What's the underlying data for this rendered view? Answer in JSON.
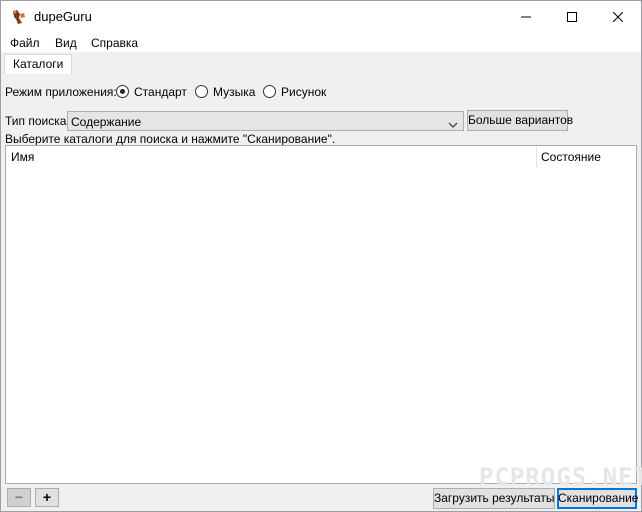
{
  "window": {
    "title": "dupeGuru",
    "controls": [
      "minimize-icon",
      "maximize-icon",
      "close-icon"
    ]
  },
  "menu": {
    "items": [
      {
        "label": "Файл"
      },
      {
        "label": "Вид"
      },
      {
        "label": "Справка"
      }
    ]
  },
  "tabs": [
    {
      "label": "Каталоги",
      "active": true
    }
  ],
  "mode": {
    "label": "Режим приложения:",
    "options": [
      {
        "label": "Стандарт",
        "checked": true
      },
      {
        "label": "Музыка",
        "checked": false
      },
      {
        "label": "Рисунок",
        "checked": false
      }
    ]
  },
  "search": {
    "label": "Тип поиска:",
    "selected": "Содержание",
    "more_button": "Больше вариантов"
  },
  "hint": "Выберите каталоги для поиска и нажмите \"Сканирование\".",
  "table": {
    "columns": [
      "Имя",
      "Состояние"
    ],
    "rows": []
  },
  "footer": {
    "remove_label": "−",
    "add_label": "+",
    "load_results": "Загрузить результаты",
    "scan": "Сканирование"
  },
  "watermark": "PCPROGS.NET"
}
